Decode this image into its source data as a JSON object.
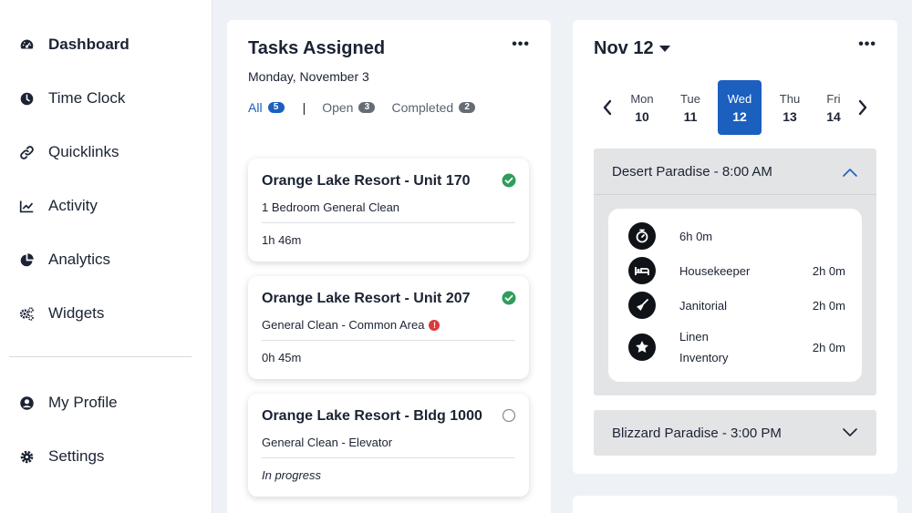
{
  "sidebar": {
    "items": [
      {
        "label": "Dashboard",
        "icon": "speedometer-icon",
        "active": true
      },
      {
        "label": "Time Clock",
        "icon": "clock-icon"
      },
      {
        "label": "Quicklinks",
        "icon": "link-icon"
      },
      {
        "label": "Activity",
        "icon": "line-chart-icon"
      },
      {
        "label": "Analytics",
        "icon": "pie-chart-icon"
      },
      {
        "label": "Widgets",
        "icon": "gears-icon"
      }
    ],
    "bottom_items": [
      {
        "label": "My Profile",
        "icon": "user-circle-icon"
      },
      {
        "label": "Settings",
        "icon": "gear-icon"
      }
    ]
  },
  "tasks": {
    "title": "Tasks Assigned",
    "more": "•••",
    "date": "Monday, November 3",
    "filters": {
      "all": {
        "label": "All",
        "count": "5"
      },
      "separator": "|",
      "open": {
        "label": "Open",
        "count": "3"
      },
      "completed": {
        "label": "Completed",
        "count": "2"
      }
    },
    "items": [
      {
        "title": "Orange Lake Resort - Unit 170",
        "subtitle": "1 Bedroom General Clean",
        "time": "1h 46m",
        "status": "completed"
      },
      {
        "title": "Orange Lake Resort - Unit 207",
        "subtitle": "General Clean - Common Area",
        "time": "0h 45m",
        "status": "completed",
        "warning": "!"
      },
      {
        "title": "Orange Lake Resort - Bldg 1000",
        "subtitle": "General Clean - Elevator",
        "time": "In progress",
        "status": "open"
      }
    ]
  },
  "schedule": {
    "month": "Nov 12",
    "more": "•••",
    "days": [
      {
        "name": "Mon",
        "date": "10"
      },
      {
        "name": "Tue",
        "date": "11"
      },
      {
        "name": "Wed",
        "date": "12",
        "selected": true
      },
      {
        "name": "Thu",
        "date": "13"
      },
      {
        "name": "Fri",
        "date": "14"
      }
    ],
    "shifts": [
      {
        "header": "Desert Paradise - 8:00 AM",
        "expanded": true,
        "rows": [
          {
            "icon": "stopwatch-icon",
            "label": "6h 0m",
            "value": ""
          },
          {
            "icon": "bed-icon",
            "label": "Housekeeper",
            "value": "2h 0m"
          },
          {
            "icon": "broom-icon",
            "label": "Janitorial",
            "value": "2h 0m"
          },
          {
            "icon": "star-icon",
            "label_line1": "Linen",
            "label_line2": "Inventory",
            "value": "2h 0m"
          }
        ]
      },
      {
        "header": "Blizzard Paradise - 3:00 PM",
        "expanded": false
      }
    ]
  },
  "colors": {
    "accent": "#1b5fbf",
    "success": "#2f9e5b",
    "danger": "#d93a3a",
    "background": "#eef2f7"
  }
}
